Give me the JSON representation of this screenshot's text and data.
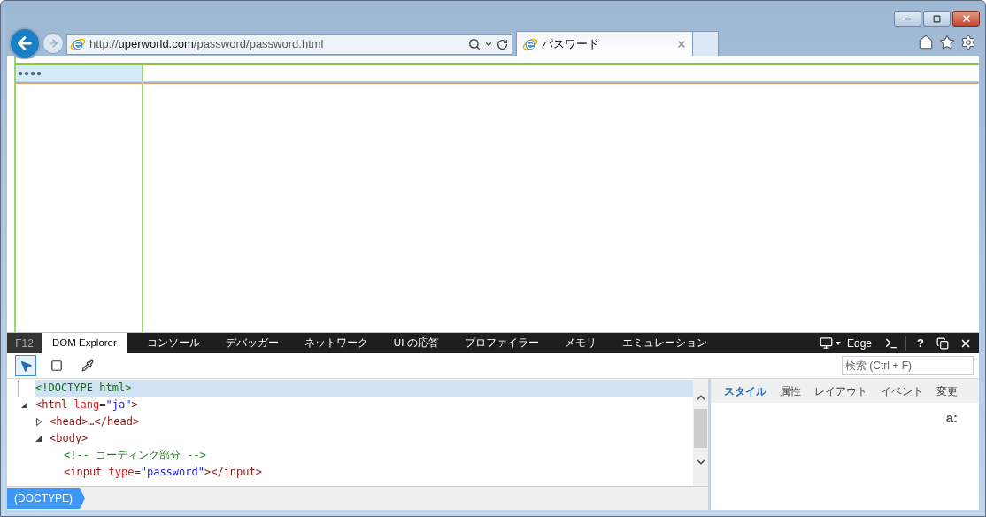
{
  "browser": {
    "address": {
      "scheme": "http://",
      "domain": "uperworld.com",
      "path": "/password/password.html"
    },
    "tabs": [
      {
        "title": "パスワード",
        "selected": true
      }
    ]
  },
  "page": {
    "password_field": {
      "value": "●●●●"
    }
  },
  "devtools": {
    "badge": "F12",
    "tabs": [
      {
        "label": "DOM Explorer",
        "selected": true
      },
      {
        "label": "コンソール",
        "selected": false
      },
      {
        "label": "デバッガー",
        "selected": false
      },
      {
        "label": "ネットワーク",
        "selected": false
      },
      {
        "label": "UI の応答",
        "selected": false
      },
      {
        "label": "プロファイラー",
        "selected": false
      },
      {
        "label": "メモリ",
        "selected": false
      },
      {
        "label": "エミュレーション",
        "selected": false
      }
    ],
    "target": "Edge",
    "help": "?",
    "tools": [
      {
        "kind": "select-element",
        "selected": true
      },
      {
        "kind": "box-model",
        "selected": false
      },
      {
        "kind": "color-picker",
        "selected": false
      }
    ],
    "search": {
      "placeholder": "検索 (Ctrl + F)"
    },
    "dom_tree": [
      {
        "selected": true,
        "tokens": [
          {
            "kind": "doctype",
            "text": "<!DOCTYPE html>"
          }
        ]
      },
      {
        "selected": false,
        "expanded": true,
        "tokens": [
          {
            "kind": "tag",
            "text": "<html "
          },
          {
            "kind": "attr",
            "text": "lang"
          },
          {
            "kind": "punct",
            "text": "="
          },
          {
            "kind": "value",
            "text": "\"ja\""
          },
          {
            "kind": "tag",
            "text": ">"
          }
        ],
        "children": [
          {
            "selected": false,
            "expanded": false,
            "tokens": [
              {
                "kind": "tag",
                "text": "<head>…</head>"
              }
            ]
          },
          {
            "selected": false,
            "expanded": true,
            "tokens": [
              {
                "kind": "tag",
                "text": "<body>"
              }
            ],
            "children": [
              {
                "selected": false,
                "tokens": [
                  {
                    "kind": "comment",
                    "text": "<!-- コーディング部分 -->"
                  }
                ]
              },
              {
                "selected": false,
                "tokens": [
                  {
                    "kind": "tag",
                    "text": "<input "
                  },
                  {
                    "kind": "attr",
                    "text": "type"
                  },
                  {
                    "kind": "punct",
                    "text": "="
                  },
                  {
                    "kind": "value",
                    "text": "\"password\""
                  },
                  {
                    "kind": "tag",
                    "text": "></input>"
                  }
                ]
              }
            ]
          }
        ]
      }
    ],
    "breadcrumb": [
      "(DOCTYPE)"
    ],
    "side_tabs": [
      {
        "label": "スタイル",
        "selected": true
      },
      {
        "label": "属性",
        "selected": false
      },
      {
        "label": "レイアウト",
        "selected": false
      },
      {
        "label": "イベント",
        "selected": false
      },
      {
        "label": "変更",
        "selected": false
      }
    ],
    "pseudo_toggle": "a:"
  }
}
